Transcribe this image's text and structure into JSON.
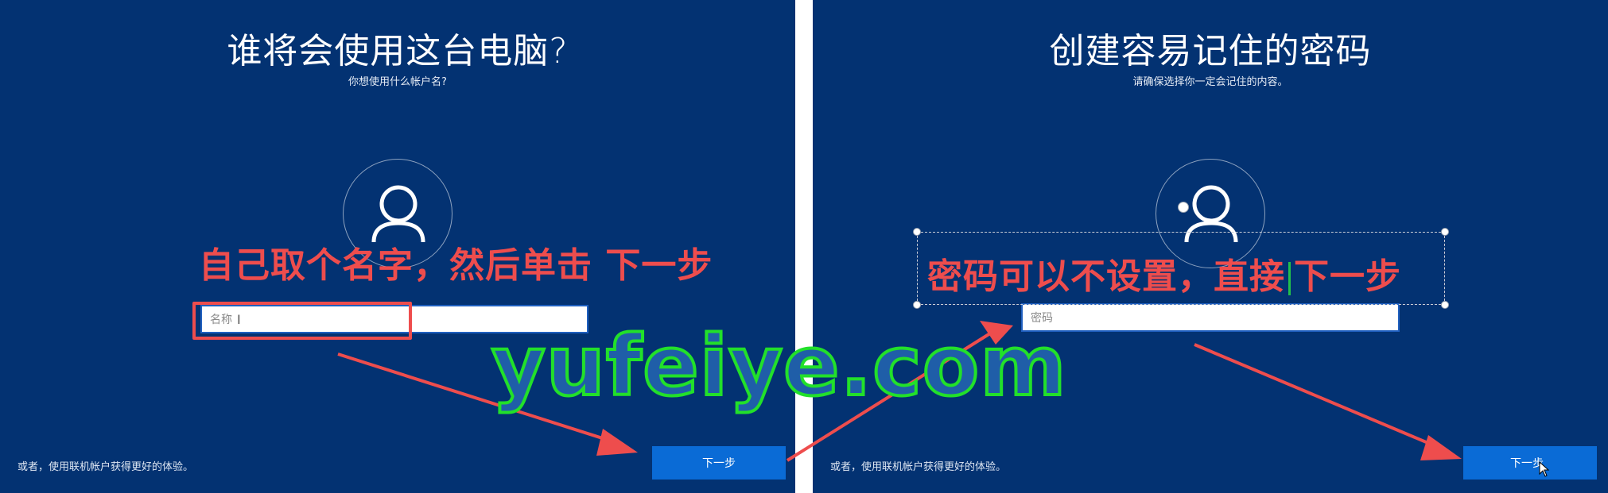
{
  "left_screen": {
    "title": "谁将会使用这台电脑?",
    "subtitle": "你想使用什么帐户名?",
    "name_field_placeholder": "名称",
    "next_button": "下一步",
    "alt_link": "或者，使用联机帐户获得更好的体验。"
  },
  "right_screen": {
    "title": "创建容易记住的密码",
    "subtitle": "请确保选择你一定会记住的内容。",
    "password_field_placeholder": "密码",
    "next_button": "下一步",
    "alt_link": "或者，使用联机帐户获得更好的体验。"
  },
  "annotations": {
    "left_instruction": "自己取个名字，然后单击 下一步",
    "right_instruction_part1": "密码可以不设置，直接",
    "right_instruction_part2": "下一步",
    "watermark": "yufeiye.com"
  },
  "colors": {
    "panel_background": "#033272",
    "button_blue": "#0a6bd6",
    "annotation_red": "#ee4d4d",
    "watermark_green": "#22e02a",
    "watermark_blue": "#1f5ea8"
  }
}
